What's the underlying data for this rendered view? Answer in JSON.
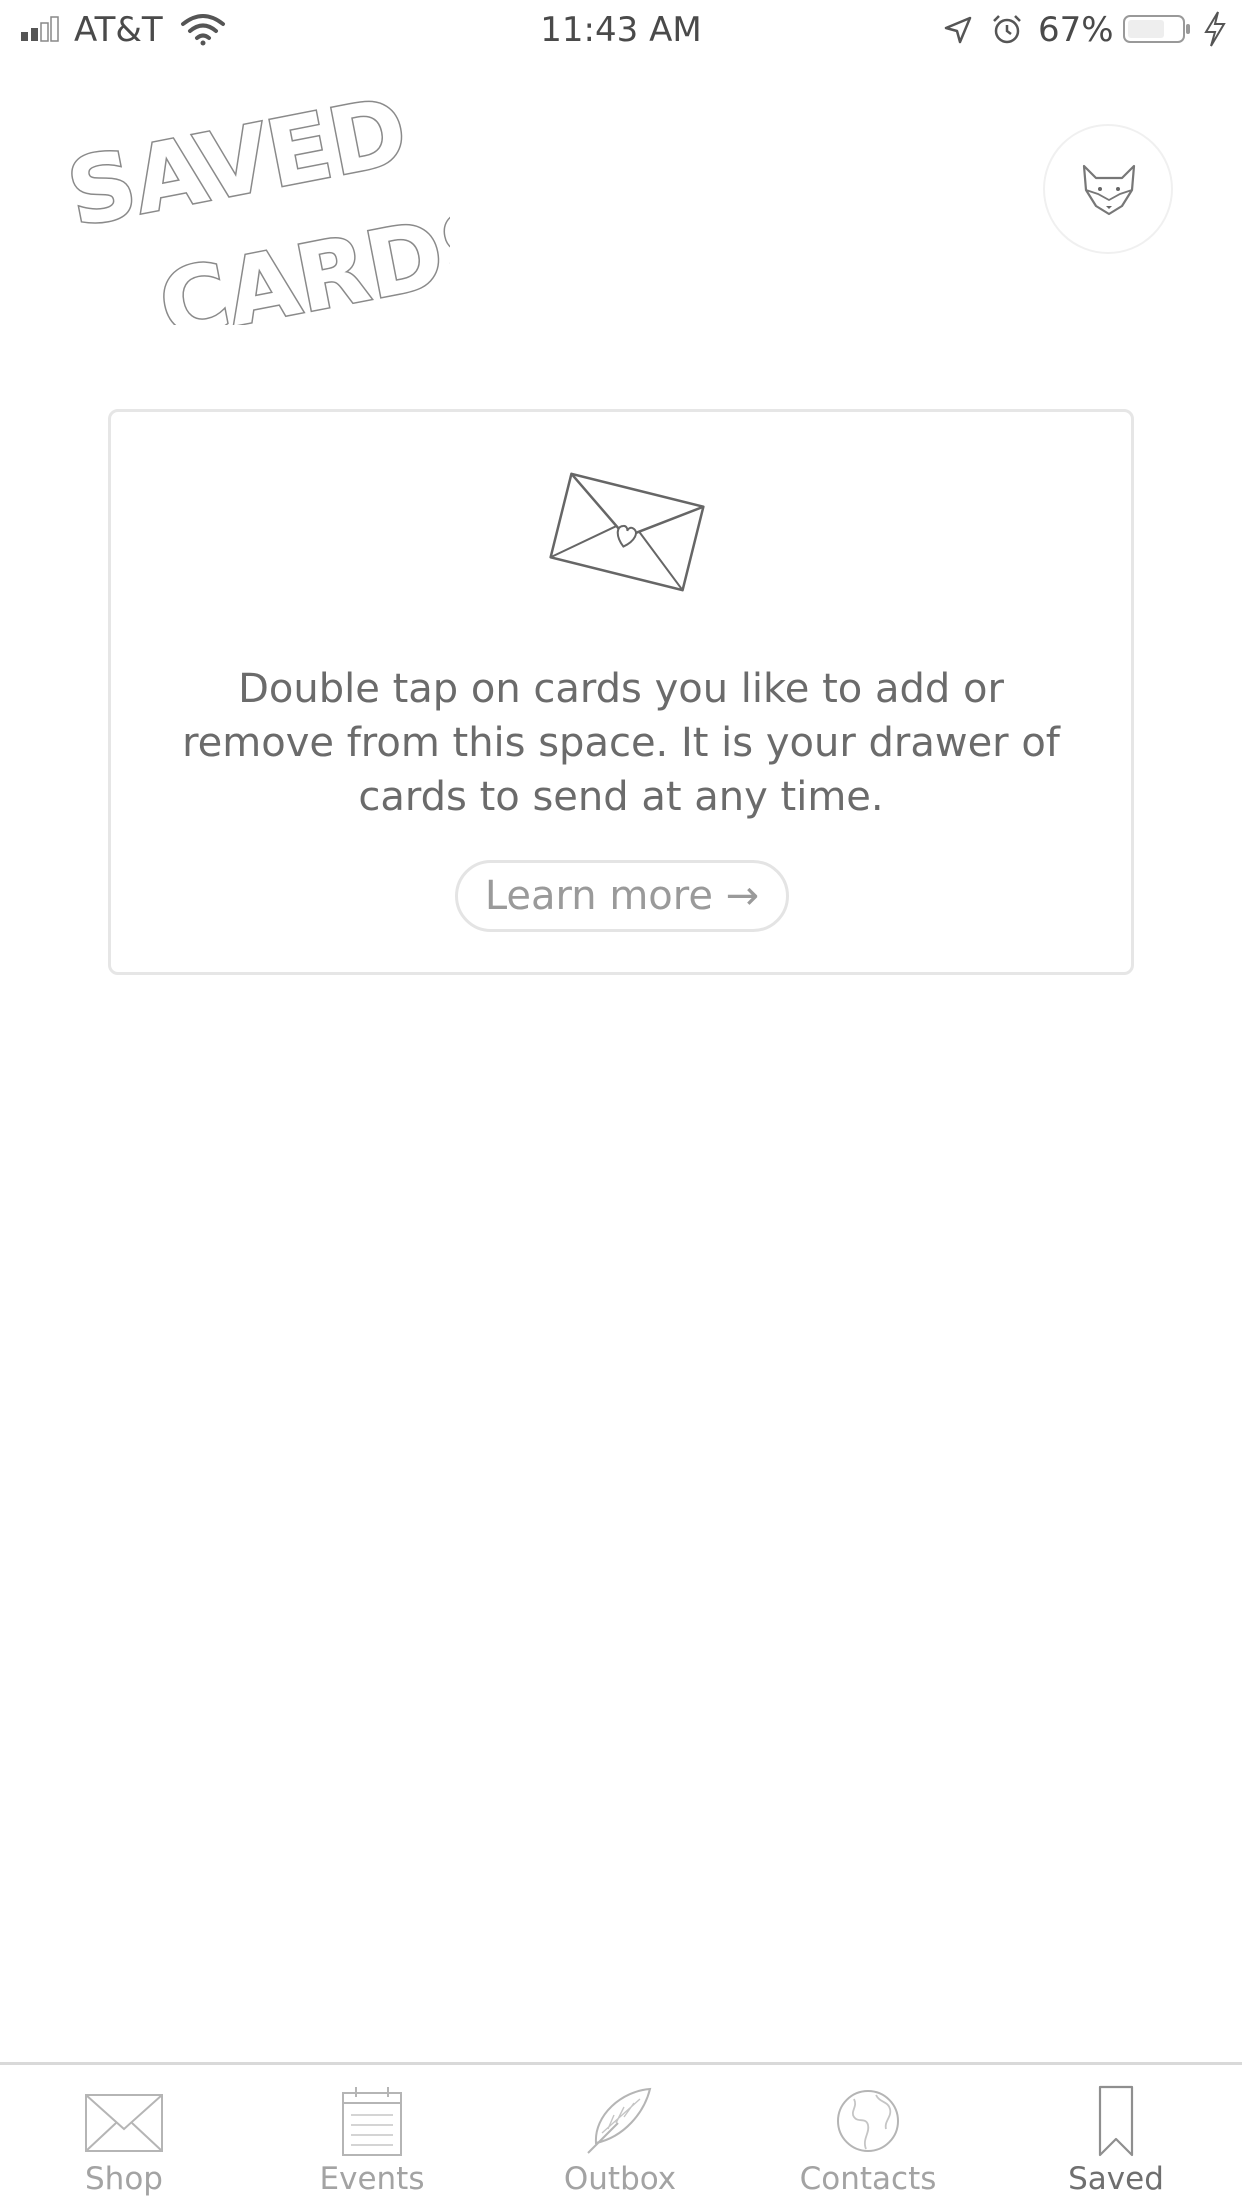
{
  "status_bar": {
    "carrier": "AT&T",
    "time": "11:43 AM",
    "battery_percent": "67%"
  },
  "header": {
    "title_line1": "SAVED",
    "title_line2": "CARDS",
    "avatar_icon": "fox-icon"
  },
  "empty_state": {
    "icon": "envelope-heart-icon",
    "message": "Double tap on cards you like to add or remove from this space. It is your drawer of cards to send at any time.",
    "learn_more_label": "Learn more →"
  },
  "tabs": [
    {
      "label": "Shop",
      "icon": "envelope-icon",
      "active": false
    },
    {
      "label": "Events",
      "icon": "calendar-icon",
      "active": false
    },
    {
      "label": "Outbox",
      "icon": "feather-icon",
      "active": false
    },
    {
      "label": "Contacts",
      "icon": "globe-icon",
      "active": false
    },
    {
      "label": "Saved",
      "icon": "bookmark-icon",
      "active": true
    }
  ],
  "colors": {
    "text": "#6b6b6b",
    "muted": "#a3a3a3",
    "border": "#e6e6e6"
  }
}
